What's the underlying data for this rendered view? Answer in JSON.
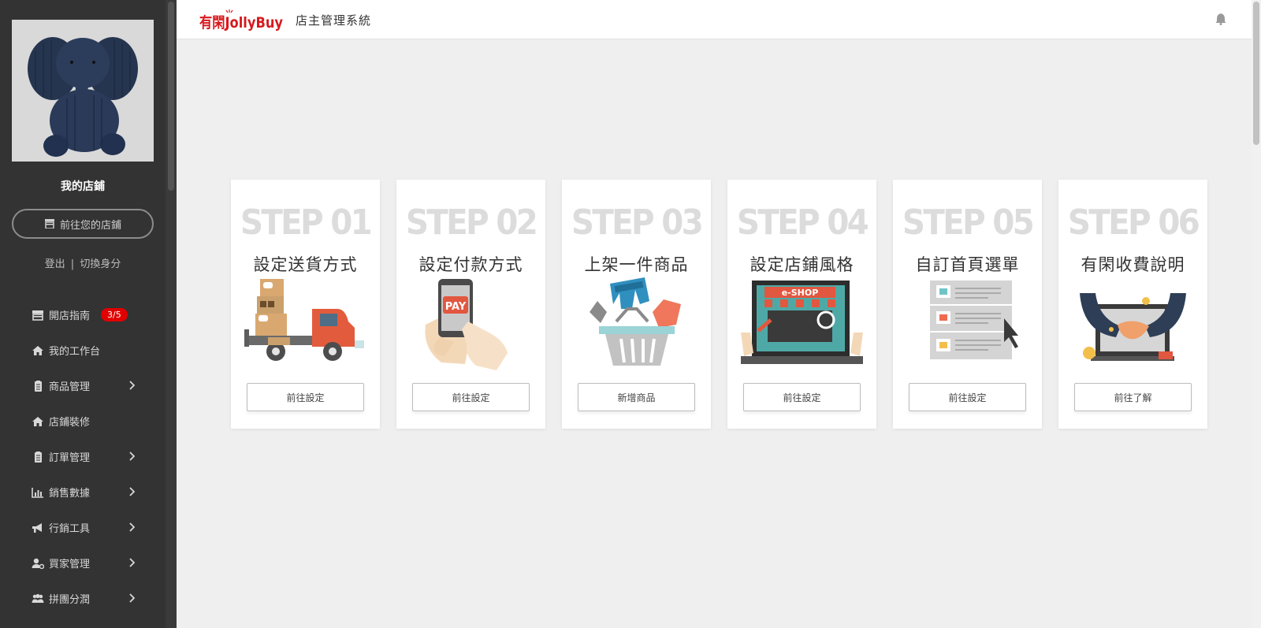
{
  "header": {
    "logo_text": "有閑JollyBuy",
    "system_title": "店主管理系統"
  },
  "sidebar": {
    "shop_name": "我的店鋪",
    "goto_shop_label": "前往您的店鋪",
    "logout_label": "登出",
    "separator": "|",
    "switch_identity_label": "切換身分",
    "items": [
      {
        "label": "開店指南",
        "icon": "store-icon",
        "badge": "3/5"
      },
      {
        "label": "我的工作台",
        "icon": "home-icon"
      },
      {
        "label": "商品管理",
        "icon": "clipboard-icon",
        "has_submenu": true
      },
      {
        "label": "店鋪裝修",
        "icon": "home-icon"
      },
      {
        "label": "訂單管理",
        "icon": "clipboard-icon",
        "has_submenu": true
      },
      {
        "label": "銷售數據",
        "icon": "bar-chart-icon",
        "has_submenu": true
      },
      {
        "label": "行銷工具",
        "icon": "megaphone-icon",
        "has_submenu": true
      },
      {
        "label": "買家管理",
        "icon": "user-cog-icon",
        "has_submenu": true
      },
      {
        "label": "拼團分潤",
        "icon": "users-icon",
        "has_submenu": true
      }
    ]
  },
  "steps": [
    {
      "step": "STEP 01",
      "title": "設定送貨方式",
      "button": "前往設定",
      "illustration": "delivery-truck"
    },
    {
      "step": "STEP 02",
      "title": "設定付款方式",
      "button": "前往設定",
      "illustration": "mobile-pay"
    },
    {
      "step": "STEP 03",
      "title": "上架一件商品",
      "button": "新增商品",
      "illustration": "shopping-basket"
    },
    {
      "step": "STEP 04",
      "title": "設定店鋪風格",
      "button": "前往設定",
      "illustration": "e-shop-laptop"
    },
    {
      "step": "STEP 05",
      "title": "自訂首頁選單",
      "button": "前往設定",
      "illustration": "menu-list-cursor"
    },
    {
      "step": "STEP 06",
      "title": "有閑收費說明",
      "button": "前往了解",
      "illustration": "handshake-laptop"
    }
  ],
  "illustration_text": {
    "pay": "PAY",
    "eshop": "e-SHOP"
  },
  "colors": {
    "sidebar_bg": "#333333",
    "badge_red": "#e00000",
    "logo_red": "#d7191e",
    "step_gray": "#dcdcdc"
  }
}
